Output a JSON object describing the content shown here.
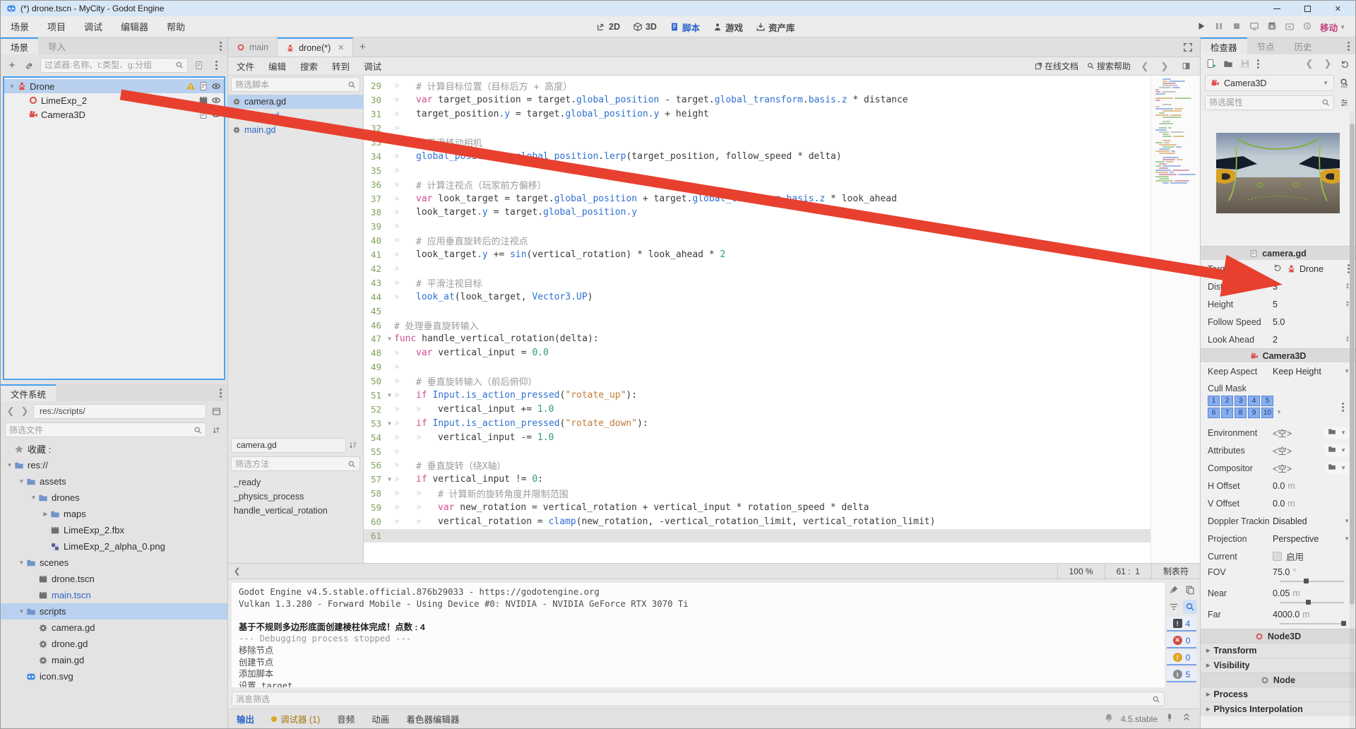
{
  "window": {
    "title": "(*) drone.tscn - MyCity - Godot Engine"
  },
  "menus": [
    "场景",
    "项目",
    "调试",
    "编辑器",
    "帮助"
  ],
  "workspaces": [
    {
      "label": "2D",
      "icon": "2d",
      "active": false
    },
    {
      "label": "3D",
      "icon": "3d",
      "active": false
    },
    {
      "label": "脚本",
      "icon": "script-blue",
      "active": true
    },
    {
      "label": "游戏",
      "icon": "game",
      "active": false
    },
    {
      "label": "资产库",
      "icon": "assetlib",
      "active": false
    }
  ],
  "run_bar": {
    "movie_label": "移动"
  },
  "scene_dock": {
    "tabs": [
      "场景",
      "导入"
    ],
    "filter_placeholder": "过滤器:名称、t:类型、g:分组",
    "nodes": [
      {
        "name": "Drone",
        "icon": "person",
        "depth": 0,
        "arrow": "open",
        "selected": true,
        "badges": [
          "warning",
          "script",
          "eye"
        ]
      },
      {
        "name": "LimeExp_2",
        "icon": "circle-o",
        "depth": 1,
        "arrow": "none",
        "selected": false,
        "badges": [
          "film",
          "eye"
        ]
      },
      {
        "name": "Camera3D",
        "icon": "camera",
        "depth": 1,
        "arrow": "none",
        "selected": false,
        "badges": [
          "script",
          "eye"
        ]
      }
    ]
  },
  "filesystem": {
    "tab": "文件系统",
    "path": "res://scripts/",
    "filter_placeholder": "筛选文件",
    "items": [
      {
        "name": "收藏 :",
        "icon": "star",
        "depth": 0,
        "arrow": "none"
      },
      {
        "name": "res://",
        "icon": "folder",
        "depth": 0,
        "arrow": "open"
      },
      {
        "name": "assets",
        "icon": "folder",
        "depth": 1,
        "arrow": "open"
      },
      {
        "name": "drones",
        "icon": "folder",
        "depth": 2,
        "arrow": "open"
      },
      {
        "name": "maps",
        "icon": "folder",
        "depth": 3,
        "arrow": "closed"
      },
      {
        "name": "LimeExp_2.fbx",
        "icon": "film",
        "depth": 3,
        "arrow": "none"
      },
      {
        "name": "LimeExp_2_alpha_0.png",
        "icon": "image",
        "depth": 3,
        "arrow": "none"
      },
      {
        "name": "scenes",
        "icon": "folder",
        "depth": 1,
        "arrow": "open"
      },
      {
        "name": "drone.tscn",
        "icon": "film",
        "depth": 2,
        "arrow": "none"
      },
      {
        "name": "main.tscn",
        "icon": "film",
        "depth": 2,
        "arrow": "none",
        "blue": true
      },
      {
        "name": "scripts",
        "icon": "folder",
        "depth": 1,
        "arrow": "open",
        "selected": true
      },
      {
        "name": "camera.gd",
        "icon": "gear",
        "depth": 2,
        "arrow": "none"
      },
      {
        "name": "drone.gd",
        "icon": "gear",
        "depth": 2,
        "arrow": "none"
      },
      {
        "name": "main.gd",
        "icon": "gear",
        "depth": 2,
        "arrow": "none"
      },
      {
        "name": "icon.svg",
        "icon": "godot",
        "depth": 1,
        "arrow": "none"
      }
    ]
  },
  "script_editor": {
    "tabs": [
      {
        "label": "main",
        "icon": "circle-o",
        "active": false
      },
      {
        "label": "drone(*)",
        "icon": "person",
        "active": true,
        "closable": true
      }
    ],
    "menus": [
      "文件",
      "编辑",
      "搜索",
      "转到",
      "调试"
    ],
    "online_docs": "在线文档",
    "search_help": "搜索帮助",
    "scripts_filter": "筛选脚本",
    "scripts": [
      {
        "name": "camera.gd",
        "selected": true
      },
      {
        "name": "drone.gd",
        "selected": false
      },
      {
        "name": "main.gd",
        "selected": false
      }
    ],
    "current_script": "camera.gd",
    "methods_filter": "筛选方法",
    "methods": [
      "_ready",
      "_physics_process",
      "handle_vertical_rotation"
    ],
    "status": {
      "zoom": "100 %",
      "caret": "61 :  1",
      "indent": "制表符"
    },
    "lines": [
      {
        "n": 29,
        "tabs": 1,
        "fold": false,
        "text": "# 计算目标位置（目标后方 + 高度）"
      },
      {
        "n": 30,
        "tabs": 1,
        "fold": false,
        "text": "var target_position = target.global_position - target.global_transform.basis.z * distance"
      },
      {
        "n": 31,
        "tabs": 1,
        "fold": false,
        "text": "target_position.y = target.global_position.y + height"
      },
      {
        "n": 32,
        "tabs": 1,
        "fold": false,
        "text": ""
      },
      {
        "n": 33,
        "tabs": 1,
        "fold": false,
        "text": "# 平滑移动相机"
      },
      {
        "n": 34,
        "tabs": 1,
        "fold": false,
        "text": "global_position = global_position.lerp(target_position, follow_speed * delta)"
      },
      {
        "n": 35,
        "tabs": 1,
        "fold": false,
        "text": ""
      },
      {
        "n": 36,
        "tabs": 1,
        "fold": false,
        "text": "# 计算注视点（玩家前方偏移）"
      },
      {
        "n": 37,
        "tabs": 1,
        "fold": false,
        "text": "var look_target = target.global_position + target.global_transform.basis.z * look_ahead"
      },
      {
        "n": 38,
        "tabs": 1,
        "fold": false,
        "text": "look_target.y = target.global_position.y"
      },
      {
        "n": 39,
        "tabs": 1,
        "fold": false,
        "text": ""
      },
      {
        "n": 40,
        "tabs": 1,
        "fold": false,
        "text": "# 应用垂直旋转后的注视点"
      },
      {
        "n": 41,
        "tabs": 1,
        "fold": false,
        "text": "look_target.y += sin(vertical_rotation) * look_ahead * 2"
      },
      {
        "n": 42,
        "tabs": 1,
        "fold": false,
        "text": ""
      },
      {
        "n": 43,
        "tabs": 1,
        "fold": false,
        "text": "# 平滑注视目标"
      },
      {
        "n": 44,
        "tabs": 1,
        "fold": false,
        "text": "look_at(look_target, Vector3.UP)"
      },
      {
        "n": 45,
        "tabs": 0,
        "fold": false,
        "text": ""
      },
      {
        "n": 46,
        "tabs": 0,
        "fold": false,
        "text": "# 处理垂直旋转输入"
      },
      {
        "n": 47,
        "tabs": 0,
        "fold": true,
        "text": "func handle_vertical_rotation(delta):"
      },
      {
        "n": 48,
        "tabs": 1,
        "fold": false,
        "text": "var vertical_input = 0.0"
      },
      {
        "n": 49,
        "tabs": 1,
        "fold": false,
        "text": ""
      },
      {
        "n": 50,
        "tabs": 1,
        "fold": false,
        "text": "# 垂直旋转输入（前后俯仰）"
      },
      {
        "n": 51,
        "tabs": 1,
        "fold": true,
        "text": "if Input.is_action_pressed(\"rotate_up\"):"
      },
      {
        "n": 52,
        "tabs": 2,
        "fold": false,
        "text": "vertical_input += 1.0"
      },
      {
        "n": 53,
        "tabs": 1,
        "fold": true,
        "text": "if Input.is_action_pressed(\"rotate_down\"):"
      },
      {
        "n": 54,
        "tabs": 2,
        "fold": false,
        "text": "vertical_input -= 1.0"
      },
      {
        "n": 55,
        "tabs": 1,
        "fold": false,
        "text": ""
      },
      {
        "n": 56,
        "tabs": 1,
        "fold": false,
        "text": "# 垂直旋转（绕X轴）"
      },
      {
        "n": 57,
        "tabs": 1,
        "fold": true,
        "text": "if vertical_input != 0:"
      },
      {
        "n": 58,
        "tabs": 2,
        "fold": false,
        "text": "# 计算新的旋转角度并限制范围"
      },
      {
        "n": 59,
        "tabs": 2,
        "fold": false,
        "text": "var new_rotation = vertical_rotation + vertical_input * rotation_speed * delta"
      },
      {
        "n": 60,
        "tabs": 2,
        "fold": false,
        "text": "vertical_rotation = clamp(new_rotation, -vertical_rotation_limit, vertical_rotation_limit)"
      },
      {
        "n": 61,
        "tabs": 0,
        "fold": false,
        "text": "",
        "current": true
      }
    ]
  },
  "output": {
    "lines": [
      {
        "text": "Godot Engine v4.5.stable.official.876b29033 - https://godotengine.org",
        "style": "plain"
      },
      {
        "text": "Vulkan 1.3.280 - Forward Mobile - Using Device #0: NVIDIA - NVIDIA GeForce RTX 3070 Ti",
        "style": "plain"
      },
      {
        "text": "",
        "style": "plain"
      },
      {
        "text": "基于不规则多边形底面创建棱柱体完成！点数 : 4",
        "style": "bold"
      },
      {
        "text": "--- Debugging process stopped ---",
        "style": "muted"
      },
      {
        "text": "移除节点",
        "style": "plain"
      },
      {
        "text": "创建节点",
        "style": "plain"
      },
      {
        "text": "添加脚本",
        "style": "plain"
      },
      {
        "text": "设置 target",
        "style": "plain"
      }
    ],
    "filter_placeholder": "消息筛选",
    "tabs": [
      {
        "label": "输出",
        "active": true
      },
      {
        "label": "调试器 (1)",
        "dot": true
      },
      {
        "label": "音频"
      },
      {
        "label": "动画"
      },
      {
        "label": "着色器编辑器"
      }
    ],
    "version": "4.5.stable",
    "badges": [
      {
        "kind": "dark",
        "glyph": "!",
        "count": "4"
      },
      {
        "kind": "error",
        "glyph": "✕",
        "count": "0"
      },
      {
        "kind": "warn",
        "glyph": "!",
        "count": "0"
      },
      {
        "kind": "info",
        "glyph": "i",
        "count": "5"
      }
    ]
  },
  "inspector": {
    "tabs": [
      "检查器",
      "节点",
      "历史"
    ],
    "node_selector": "Camera3D",
    "filter_placeholder": "筛选属性",
    "rows": [
      {
        "type": "header",
        "icon": "script",
        "label": "camera.gd"
      },
      {
        "type": "node",
        "label": "Target",
        "value": "Drone",
        "icon": "person"
      },
      {
        "type": "stepper",
        "label": "Distance",
        "value": "3"
      },
      {
        "type": "stepper",
        "label": "Height",
        "value": "5"
      },
      {
        "type": "plain",
        "label": "Follow Speed",
        "value": "5.0"
      },
      {
        "type": "stepper",
        "label": "Look Ahead",
        "value": "2"
      },
      {
        "type": "header",
        "icon": "camera",
        "label": "Camera3D"
      },
      {
        "type": "dropdown",
        "label": "Keep Aspect",
        "value": "Keep Height"
      },
      {
        "type": "cullmask",
        "label": "Cull Mask",
        "rows": [
          [
            "1",
            "2",
            "3",
            "4",
            "5"
          ],
          [
            "6",
            "7",
            "8",
            "9",
            "10"
          ]
        ]
      },
      {
        "type": "resource",
        "label": "Environment",
        "value": "<空>"
      },
      {
        "type": "resource",
        "label": "Attributes",
        "value": "<空>"
      },
      {
        "type": "resource",
        "label": "Compositor",
        "value": "<空>"
      },
      {
        "type": "unit",
        "label": "H Offset",
        "value": "0.0",
        "unit": "m"
      },
      {
        "type": "unit",
        "label": "V Offset",
        "value": "0.0",
        "unit": "m"
      },
      {
        "type": "dropdown",
        "label": "Doppler Trackin",
        "value": "Disabled"
      },
      {
        "type": "dropdown",
        "label": "Projection",
        "value": "Perspective"
      },
      {
        "type": "checkbox",
        "label": "Current",
        "value": "启用"
      },
      {
        "type": "slider",
        "label": "FOV",
        "value": "75.0",
        "unit": "°",
        "frac": 0.42
      },
      {
        "type": "slider",
        "label": "Near",
        "value": "0.05",
        "unit": "m",
        "frac": 0.45
      },
      {
        "type": "slider",
        "label": "Far",
        "value": "4000.0",
        "unit": "m",
        "frac": 1.0
      },
      {
        "type": "header",
        "icon": "circle-red",
        "label": "Node3D"
      },
      {
        "type": "group",
        "label": "Transform"
      },
      {
        "type": "group",
        "label": "Visibility"
      },
      {
        "type": "header",
        "icon": "circle-gray",
        "label": "Node"
      },
      {
        "type": "group",
        "label": "Process"
      },
      {
        "type": "group",
        "label": "Physics Interpolation"
      }
    ]
  },
  "colors": {
    "accent": "#44a1f1",
    "selection": "#b9d1ee",
    "arrow": "#e8402f"
  }
}
